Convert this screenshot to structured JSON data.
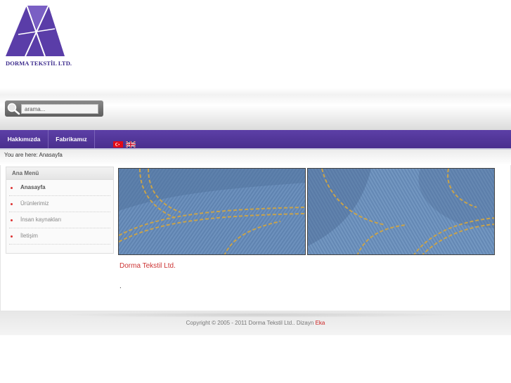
{
  "header": {
    "logo_text": "DORMA TEKSTİL LTD.",
    "search": {
      "placeholder": "arama..."
    }
  },
  "nav": {
    "items": [
      {
        "label": "Hakkımızda"
      },
      {
        "label": "Fabrikamız"
      }
    ],
    "languages": [
      "tr",
      "en"
    ]
  },
  "breadcrumb": {
    "text": "You are here: Anasayfa"
  },
  "sidebar": {
    "title": "Ana Menü",
    "items": [
      {
        "label": "Anasayfa",
        "active": true
      },
      {
        "label": "Ürünlerimiz",
        "active": false
      },
      {
        "label": "İnsan kaynakları",
        "active": false
      },
      {
        "label": "İletişim",
        "active": false
      }
    ]
  },
  "main": {
    "company_name": "Dorma Tekstil Ltd.",
    "body_text": "."
  },
  "footer": {
    "copyright": "Copyright © 2005 - 2011 Dorma Tekstil Ltd.. Dizayn",
    "credit": "Eka"
  },
  "colors": {
    "brand_purple": "#4a2f8e",
    "accent_red": "#cc3333"
  }
}
